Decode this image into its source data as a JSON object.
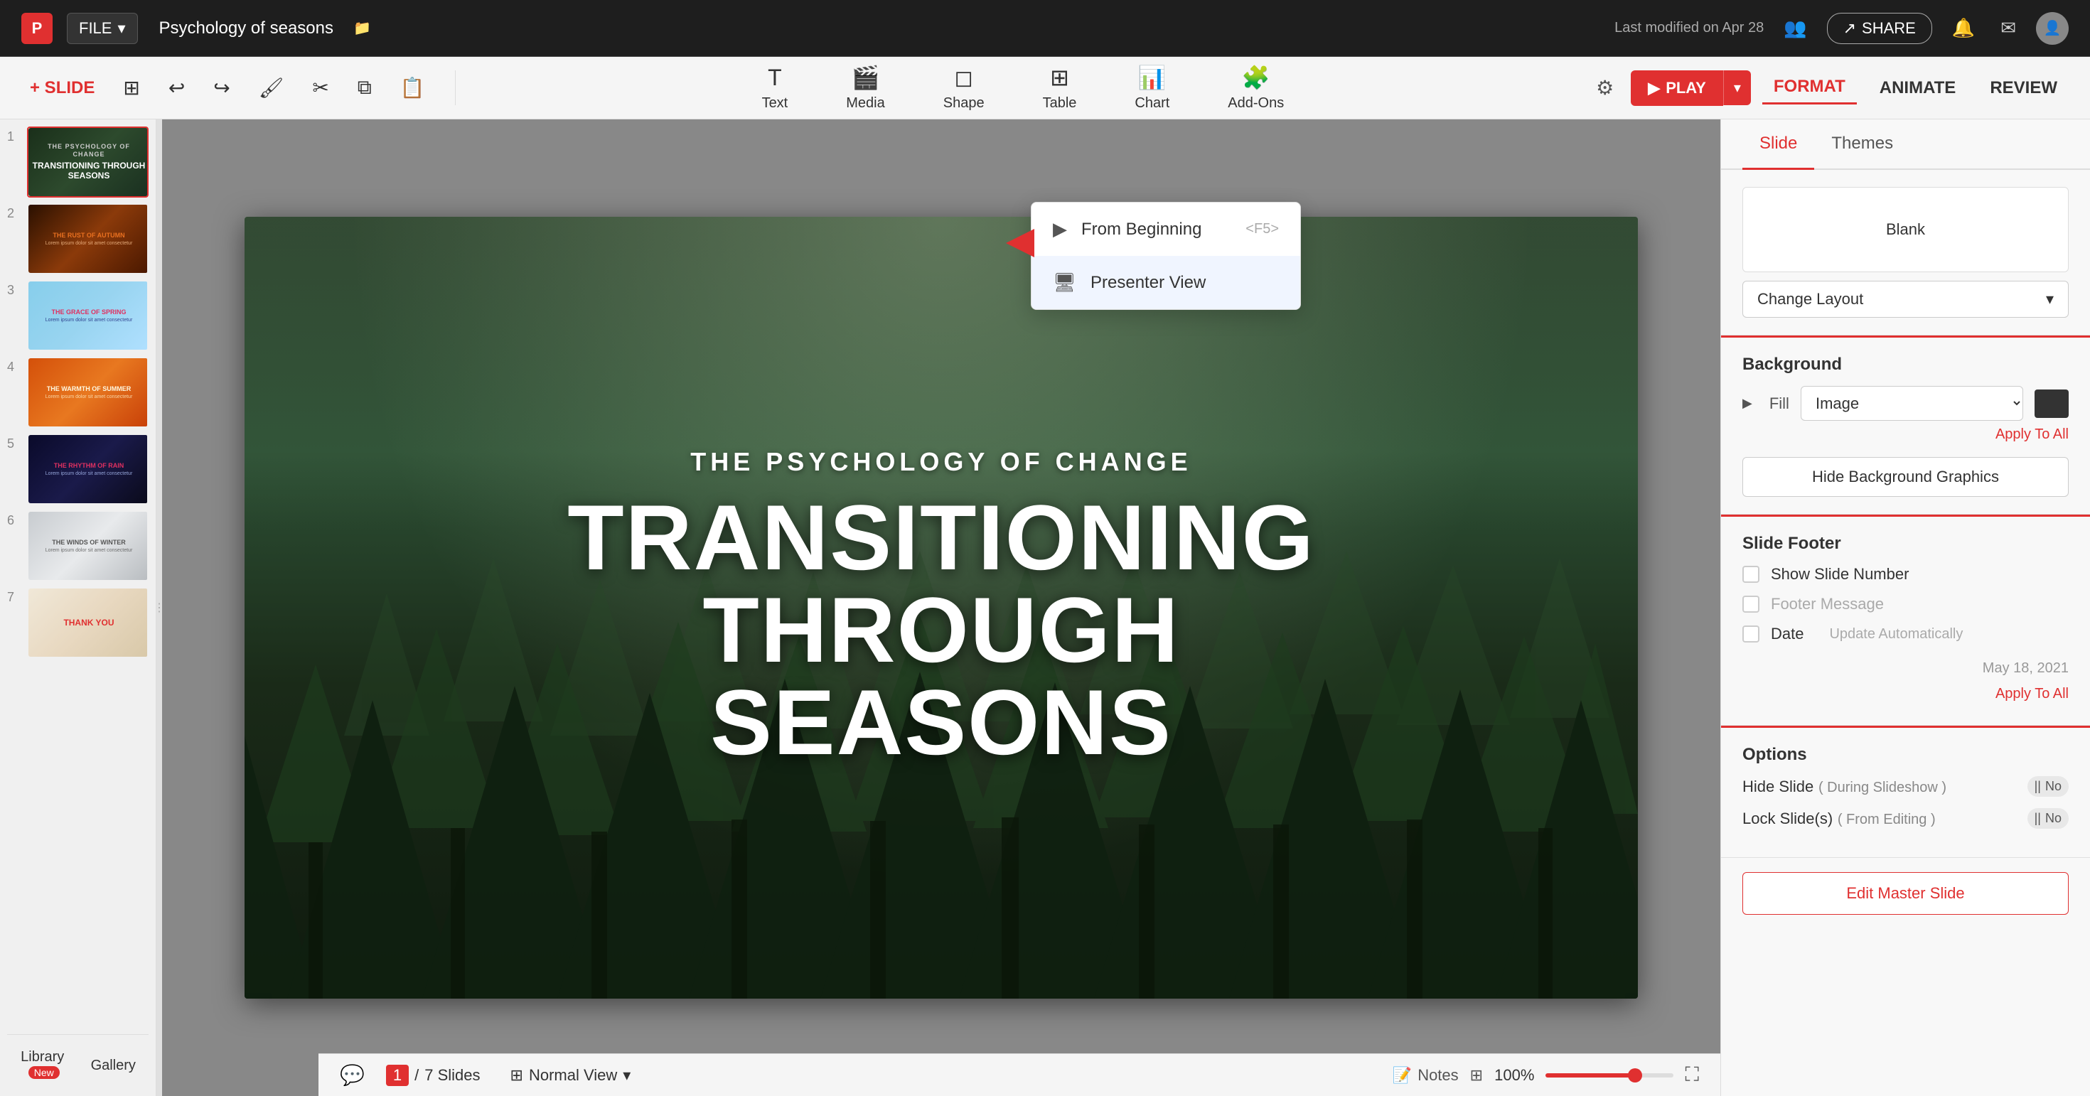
{
  "app": {
    "icon": "P",
    "file_label": "FILE",
    "doc_title": "Psychology of seasons",
    "last_modified": "Last modified on Apr 28",
    "share_label": "SHARE"
  },
  "toolbar": {
    "slide_label": "+ SLIDE",
    "undo_label": "↩",
    "redo_label": "↪",
    "paint_label": "🎨",
    "cut_label": "✂",
    "copy_label": "⧉",
    "paste_label": "📋",
    "text_label": "Text",
    "media_label": "Media",
    "shape_label": "Shape",
    "table_label": "Table",
    "chart_label": "Chart",
    "addons_label": "Add-Ons",
    "play_label": "PLAY",
    "format_label": "FORMAT",
    "animate_label": "ANIMATE",
    "review_label": "REVIEW"
  },
  "slides": [
    {
      "num": 1,
      "title": "TRANSITIONING THROUGH SEASONS",
      "subtitle": "THE PSYCHOLOGY OF CHANGE",
      "theme": "forest",
      "active": true
    },
    {
      "num": 2,
      "title": "THE RUST OF AUTUMN",
      "subtitle": "",
      "theme": "autumn"
    },
    {
      "num": 3,
      "title": "THE GRACE OF SPRING",
      "subtitle": "",
      "theme": "spring"
    },
    {
      "num": 4,
      "title": "THE WARMTH OF SUMMER",
      "subtitle": "",
      "theme": "summer"
    },
    {
      "num": 5,
      "title": "THE RHYTHM OF RAIN",
      "subtitle": "",
      "theme": "rain"
    },
    {
      "num": 6,
      "title": "THE WINDS OF WINTER",
      "subtitle": "",
      "theme": "winter"
    },
    {
      "num": 7,
      "title": "THANK YOU",
      "subtitle": "",
      "theme": "thankyou"
    }
  ],
  "main_slide": {
    "subtitle": "THE PSYCHOLOGY OF CHANGE",
    "title_line1": "TRANSITIONING THROUGH",
    "title_line2": "SEASONS"
  },
  "dropdown": {
    "from_beginning": "From Beginning",
    "from_beginning_shortcut": "<F5>",
    "presenter_view": "Presenter View"
  },
  "right_panel": {
    "tabs": [
      "Slide",
      "Themes"
    ],
    "active_tab": "Slide",
    "layout_label": "Blank",
    "change_layout_label": "Change Layout",
    "background_title": "Background",
    "fill_label": "Fill",
    "fill_option": "Image",
    "apply_to_all": "Apply To All",
    "hide_bg_btn": "Hide Background Graphics",
    "slide_footer_title": "Slide Footer",
    "show_slide_number": "Show Slide Number",
    "footer_message": "Footer Message",
    "date_label": "Date",
    "date_auto": "Update Automatically",
    "date_value": "May 18, 2021",
    "apply_to_all2": "Apply To All",
    "options_title": "Options",
    "hide_slide_label": "Hide Slide",
    "hide_slide_sublabel": "( During Slideshow )",
    "lock_slide_label": "Lock Slide(s)",
    "lock_slide_sublabel": "( From Editing )",
    "toggle_no": "No",
    "edit_master": "Edit Master Slide"
  },
  "bottom_bar": {
    "current_slide": "1",
    "total_slides": "7 Slides",
    "view_label": "Normal View",
    "notes_label": "Notes",
    "zoom_label": "100%",
    "library_label": "Library",
    "gallery_label": "Gallery",
    "new_badge": "New"
  }
}
